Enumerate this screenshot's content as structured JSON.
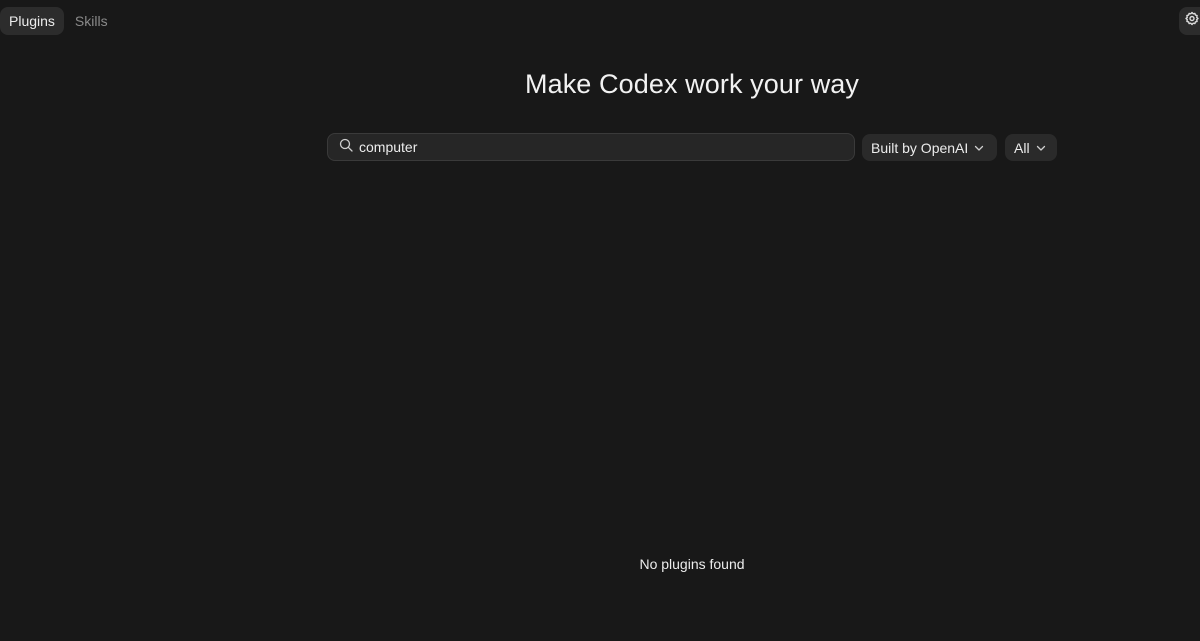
{
  "tabs": [
    {
      "label": "Plugins",
      "active": true
    },
    {
      "label": "Skills",
      "active": false
    }
  ],
  "settings": {
    "icon": "gear-icon"
  },
  "heading": "Make Codex work your way",
  "search": {
    "value": "computer",
    "icon": "search-icon"
  },
  "filters": {
    "builder": {
      "selected": "Built by OpenAI",
      "icon": "chevron-down-icon"
    },
    "category": {
      "selected": "All",
      "icon": "chevron-down-icon"
    }
  },
  "empty_state": "No plugins found",
  "colors": {
    "background": "#181818",
    "surface": "#2c2c2c",
    "text": "#ececec",
    "muted": "#8a8a8a"
  }
}
